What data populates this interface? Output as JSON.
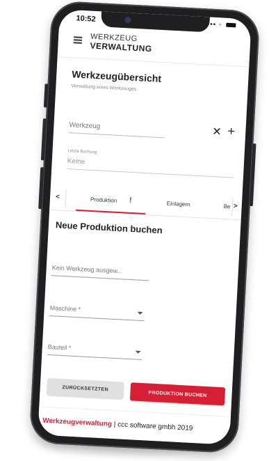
{
  "status": {
    "time": "10:52"
  },
  "appbar": {
    "line1": "WERKZEUG",
    "line2": "VERWALTUNG"
  },
  "overview": {
    "title": "Werkzeugübersicht",
    "subtitle": "Verwaltung eines Werkzeuges",
    "tool_placeholder": "Werkzeug",
    "last_booking_label": "Letzte Buchung",
    "last_booking_value": "Keine"
  },
  "tabs": {
    "items": [
      "Produktion",
      "Einlagern",
      "Be"
    ],
    "alert": "!"
  },
  "form": {
    "title": "Neue Produktion buchen",
    "tool_field": "Kein Werkzeug ausgew...",
    "machine_field": "Maschine *",
    "part_field": "Bauteil *",
    "reset_label": "ZURÜCKSETZTEN",
    "book_label": "PRODUKTION BUCHEN"
  },
  "footer": {
    "brand": "Werkzeugverwaltung",
    "rest": " | ccc software gmbh 2019"
  },
  "colors": {
    "accent": "#d51f35"
  }
}
